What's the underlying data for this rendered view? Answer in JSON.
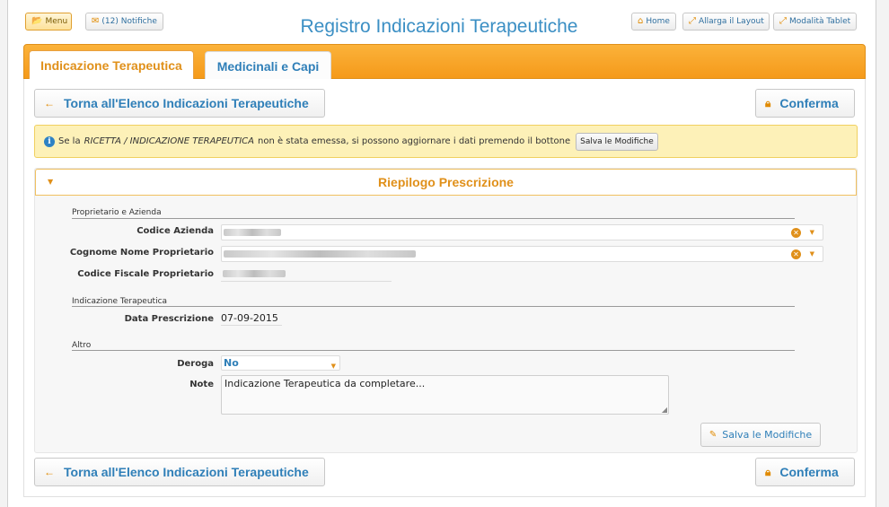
{
  "topbar": {
    "menu_label": "Menu",
    "notifications_label": "(12) Notifiche",
    "home_label": "Home",
    "widen_label": "Allarga il Layout",
    "tablet_label": "Modalità Tablet"
  },
  "page_title": "Registro Indicazioni Terapeutiche",
  "tabs": [
    {
      "label": "Indicazione Terapeutica",
      "active": true
    },
    {
      "label": "Medicinali e Capi",
      "active": false
    }
  ],
  "actions": {
    "back_label": "Torna all'Elenco Indicazioni Terapeutiche",
    "confirm_label": "Conferma"
  },
  "info": {
    "text_prefix": "Se la",
    "text_em": "RICETTA / INDICAZIONE TERAPEUTICA",
    "text_suffix": "non è stata emessa, si possono aggiornare i dati premendo il bottone",
    "button_label": "Salva le Modifiche"
  },
  "panel": {
    "title": "Riepilogo Prescrizione",
    "sections": {
      "owner": "Proprietario e Azienda",
      "indication": "Indicazione Terapeutica",
      "other": "Altro"
    },
    "fields": {
      "codice_azienda_label": "Codice Azienda",
      "cognome_nome_label": "Cognome Nome Proprietario",
      "codice_fiscale_label": "Codice Fiscale Proprietario",
      "data_prescrizione_label": "Data Prescrizione",
      "data_prescrizione_value": "07-09-2015",
      "deroga_label": "Deroga",
      "deroga_value": "No",
      "note_label": "Note",
      "note_value": "Indicazione Terapeutica da completare..."
    },
    "save_label": "Salva le Modifiche"
  },
  "colors": {
    "accent_orange": "#f59a1a",
    "link_blue": "#2f7fb8",
    "info_bg": "#fdf1b8"
  }
}
